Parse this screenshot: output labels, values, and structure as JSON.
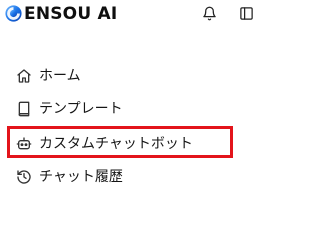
{
  "header": {
    "brand": "ENSOU AI",
    "icons": {
      "logo": "ensou-logo",
      "bell": "bell-icon",
      "panel": "sidebar-toggle-icon"
    }
  },
  "nav": {
    "items": [
      {
        "label": "ホーム",
        "icon": "home-icon"
      },
      {
        "label": "テンプレート",
        "icon": "book-icon"
      },
      {
        "label": "カスタムチャットボット",
        "icon": "bot-icon"
      },
      {
        "label": "チャット履歴",
        "icon": "history-icon"
      }
    ],
    "highlighted_index": 2
  },
  "colors": {
    "logo_blue": "#1a73e8",
    "highlight_red": "#e3141b",
    "text": "#151515"
  }
}
